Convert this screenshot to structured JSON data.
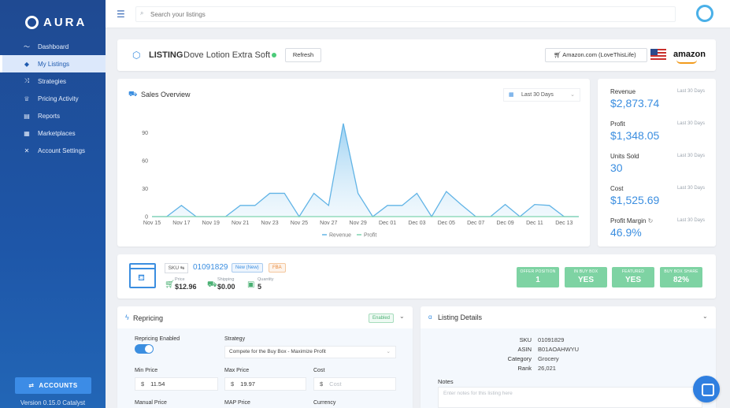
{
  "app": {
    "brand": "AURA",
    "version": "Version 0.15.0 Catalyst",
    "accounts_label": "ACCOUNTS"
  },
  "sidebar": {
    "items": [
      {
        "label": "Dashboard",
        "icon": "chart-line-icon"
      },
      {
        "label": "My Listings",
        "icon": "tag-icon",
        "active": true
      },
      {
        "label": "Strategies",
        "icon": "shuffle-icon"
      },
      {
        "label": "Pricing Activity",
        "icon": "trophy-icon"
      },
      {
        "label": "Reports",
        "icon": "clipboard-icon"
      },
      {
        "label": "Marketplaces",
        "icon": "store-icon"
      },
      {
        "label": "Account Settings",
        "icon": "tools-icon"
      }
    ]
  },
  "search": {
    "placeholder": "Search your listings"
  },
  "listing": {
    "label": "LISTING",
    "name": "Dove Lotion Extra Soft",
    "refresh_label": "Refresh",
    "store": "Amazon.com (LoveThisLife)",
    "marketplace_logo": "amazon"
  },
  "sales": {
    "title": "Sales Overview",
    "range": "Last 30 Days",
    "legend_revenue": "Revenue",
    "legend_profit": "Profit"
  },
  "chart_data": {
    "type": "area",
    "x": [
      "Nov 15",
      "Nov 16",
      "Nov 17",
      "Nov 18",
      "Nov 19",
      "Nov 20",
      "Nov 21",
      "Nov 22",
      "Nov 23",
      "Nov 24",
      "Nov 25",
      "Nov 26",
      "Nov 27",
      "Nov 28",
      "Nov 29",
      "Nov 30",
      "Dec 01",
      "Dec 02",
      "Dec 03",
      "Dec 04",
      "Dec 05",
      "Dec 06",
      "Dec 07",
      "Dec 08",
      "Dec 09",
      "Dec 10",
      "Dec 11",
      "Dec 12",
      "Dec 13",
      "Dec 14"
    ],
    "x_tick_labels": [
      "Nov 15",
      "Nov 17",
      "Nov 19",
      "Nov 21",
      "Nov 23",
      "Nov 25",
      "Nov 27",
      "Nov 29",
      "Dec 01",
      "Dec 03",
      "Dec 05",
      "Dec 07",
      "Dec 09",
      "Dec 11",
      "Dec 13"
    ],
    "y_ticks": [
      0,
      30,
      60,
      90
    ],
    "ylim": [
      0,
      110
    ],
    "series": [
      {
        "name": "Revenue",
        "color": "#62b4e6",
        "values": [
          0,
          0,
          12,
          0,
          0,
          0,
          12,
          12,
          25,
          25,
          0,
          25,
          12,
          100,
          25,
          0,
          12,
          12,
          25,
          0,
          27,
          13,
          0,
          0,
          13,
          0,
          13,
          12,
          0,
          0
        ]
      },
      {
        "name": "Profit",
        "color": "#7fd4b0",
        "values": [
          0,
          0,
          0,
          0,
          0,
          0,
          0,
          0,
          0,
          0,
          0,
          0,
          0,
          0,
          0,
          0,
          0,
          0,
          0,
          0,
          0,
          0,
          0,
          0,
          0,
          0,
          0,
          0,
          0,
          0
        ]
      }
    ],
    "legend": "bottom-center",
    "grid": false
  },
  "stats": [
    {
      "label": "Revenue",
      "period": "Last 30 Days",
      "value": "$2,873.74"
    },
    {
      "label": "Profit",
      "period": "Last 30 Days",
      "value": "$1,348.05"
    },
    {
      "label": "Units Sold",
      "period": "Last 30 Days",
      "value": "30"
    },
    {
      "label": "Cost",
      "period": "Last 30 Days",
      "value": "$1,525.69"
    },
    {
      "label": "Profit Margin",
      "period": "Last 30 Days",
      "value": "46.9%"
    }
  ],
  "product": {
    "sku_label": "SKU",
    "sku": "01091829",
    "condition": "New (New)",
    "fulfillment": "FBA",
    "price_label": "Price",
    "price": "$12.96",
    "shipping_label": "Shipping",
    "shipping": "$0.00",
    "quantity_label": "Quantity",
    "quantity": "5",
    "kpis": [
      {
        "label": "OFFER POSITION",
        "value": "1"
      },
      {
        "label": "IN BUY BOX",
        "value": "YES"
      },
      {
        "label": "FEATURED",
        "value": "YES"
      },
      {
        "label": "BUY BOX SHARE",
        "value": "82%"
      }
    ]
  },
  "repricing": {
    "title": "Repricing",
    "status": "Enabled",
    "enabled_label": "Repricing Enabled",
    "strategy_label": "Strategy",
    "strategy_value": "Compete for the Buy Box - Maximize Profit",
    "min_label": "Min Price",
    "min_value": "11.54",
    "max_label": "Max Price",
    "max_value": "19.97",
    "cost_label": "Cost",
    "cost_placeholder": "Cost",
    "currency_symbol": "$",
    "manual_label": "Manual Price",
    "map_label": "MAP Price",
    "currency_label": "Currency"
  },
  "details": {
    "title": "Listing Details",
    "rows": [
      {
        "k": "SKU",
        "v": "01091829"
      },
      {
        "k": "ASIN",
        "v": "B01AOAHWYU"
      },
      {
        "k": "Category",
        "v": "Grocery"
      },
      {
        "k": "Rank",
        "v": "26,021"
      }
    ],
    "notes_label": "Notes",
    "notes_placeholder": "Enter notes for this listing here"
  }
}
